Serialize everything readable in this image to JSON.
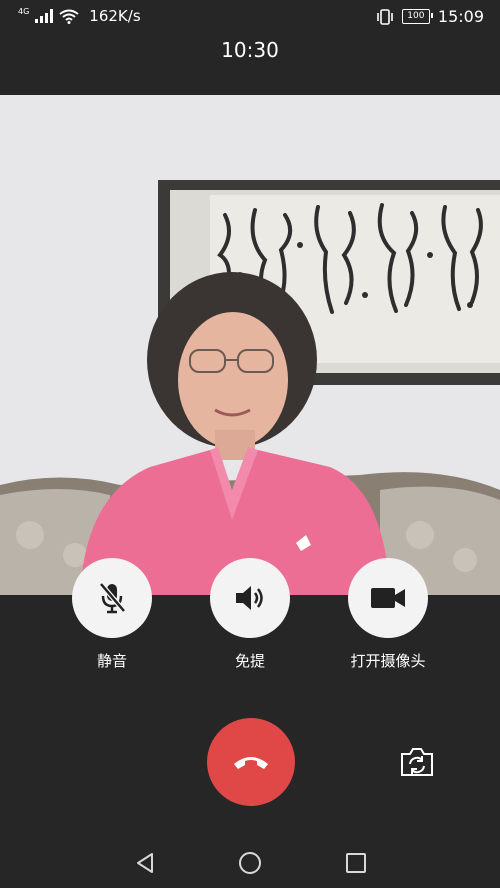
{
  "status_bar": {
    "network": "4G",
    "speed": "162K/s",
    "battery": "100",
    "time": "15:09"
  },
  "call": {
    "duration": "10:30"
  },
  "controls": {
    "mute_label": "静音",
    "speaker_label": "免提",
    "camera_label": "打开摄像头"
  },
  "icons": {
    "mute": "mic-off-icon",
    "speaker": "speaker-icon",
    "camera": "video-camera-icon",
    "hangup": "phone-hangup-icon",
    "switch_camera": "camera-switch-icon"
  },
  "colors": {
    "background": "#262626",
    "hangup": "#e04848",
    "control_bg": "#f3f3f3"
  }
}
